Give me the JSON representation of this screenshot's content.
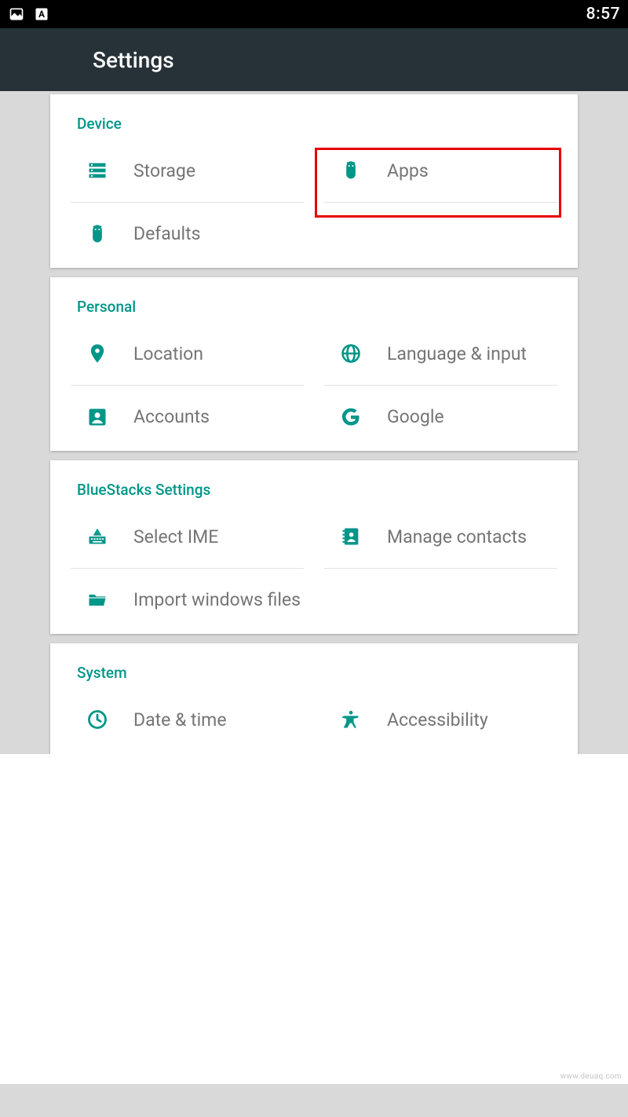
{
  "status": {
    "time": "8:57"
  },
  "header": {
    "title": "Settings"
  },
  "sections": {
    "device": {
      "title": "Device",
      "storage": "Storage",
      "apps": "Apps",
      "defaults": "Defaults"
    },
    "personal": {
      "title": "Personal",
      "location": "Location",
      "language": "Language & input",
      "accounts": "Accounts",
      "google": "Google"
    },
    "bluestacks": {
      "title": "BlueStacks Settings",
      "ime": "Select IME",
      "contacts": "Manage contacts",
      "import": "Import windows files"
    },
    "system": {
      "title": "System",
      "datetime": "Date & time",
      "accessibility": "Accessibility"
    }
  },
  "watermark": "www.deuaq.com"
}
